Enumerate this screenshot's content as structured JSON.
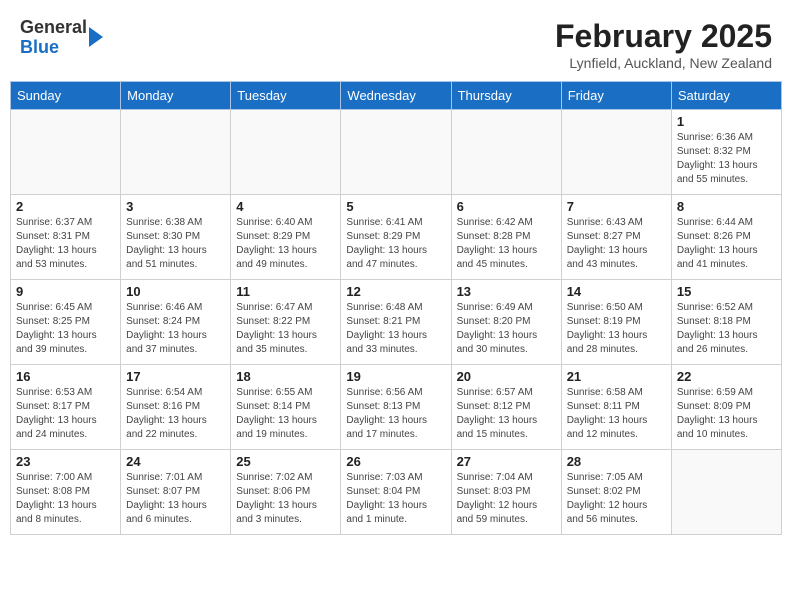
{
  "header": {
    "logo_general": "General",
    "logo_blue": "Blue",
    "month_title": "February 2025",
    "location": "Lynfield, Auckland, New Zealand"
  },
  "days_of_week": [
    "Sunday",
    "Monday",
    "Tuesday",
    "Wednesday",
    "Thursday",
    "Friday",
    "Saturday"
  ],
  "weeks": [
    [
      {
        "day": "",
        "info": ""
      },
      {
        "day": "",
        "info": ""
      },
      {
        "day": "",
        "info": ""
      },
      {
        "day": "",
        "info": ""
      },
      {
        "day": "",
        "info": ""
      },
      {
        "day": "",
        "info": ""
      },
      {
        "day": "1",
        "info": "Sunrise: 6:36 AM\nSunset: 8:32 PM\nDaylight: 13 hours\nand 55 minutes."
      }
    ],
    [
      {
        "day": "2",
        "info": "Sunrise: 6:37 AM\nSunset: 8:31 PM\nDaylight: 13 hours\nand 53 minutes."
      },
      {
        "day": "3",
        "info": "Sunrise: 6:38 AM\nSunset: 8:30 PM\nDaylight: 13 hours\nand 51 minutes."
      },
      {
        "day": "4",
        "info": "Sunrise: 6:40 AM\nSunset: 8:29 PM\nDaylight: 13 hours\nand 49 minutes."
      },
      {
        "day": "5",
        "info": "Sunrise: 6:41 AM\nSunset: 8:29 PM\nDaylight: 13 hours\nand 47 minutes."
      },
      {
        "day": "6",
        "info": "Sunrise: 6:42 AM\nSunset: 8:28 PM\nDaylight: 13 hours\nand 45 minutes."
      },
      {
        "day": "7",
        "info": "Sunrise: 6:43 AM\nSunset: 8:27 PM\nDaylight: 13 hours\nand 43 minutes."
      },
      {
        "day": "8",
        "info": "Sunrise: 6:44 AM\nSunset: 8:26 PM\nDaylight: 13 hours\nand 41 minutes."
      }
    ],
    [
      {
        "day": "9",
        "info": "Sunrise: 6:45 AM\nSunset: 8:25 PM\nDaylight: 13 hours\nand 39 minutes."
      },
      {
        "day": "10",
        "info": "Sunrise: 6:46 AM\nSunset: 8:24 PM\nDaylight: 13 hours\nand 37 minutes."
      },
      {
        "day": "11",
        "info": "Sunrise: 6:47 AM\nSunset: 8:22 PM\nDaylight: 13 hours\nand 35 minutes."
      },
      {
        "day": "12",
        "info": "Sunrise: 6:48 AM\nSunset: 8:21 PM\nDaylight: 13 hours\nand 33 minutes."
      },
      {
        "day": "13",
        "info": "Sunrise: 6:49 AM\nSunset: 8:20 PM\nDaylight: 13 hours\nand 30 minutes."
      },
      {
        "day": "14",
        "info": "Sunrise: 6:50 AM\nSunset: 8:19 PM\nDaylight: 13 hours\nand 28 minutes."
      },
      {
        "day": "15",
        "info": "Sunrise: 6:52 AM\nSunset: 8:18 PM\nDaylight: 13 hours\nand 26 minutes."
      }
    ],
    [
      {
        "day": "16",
        "info": "Sunrise: 6:53 AM\nSunset: 8:17 PM\nDaylight: 13 hours\nand 24 minutes."
      },
      {
        "day": "17",
        "info": "Sunrise: 6:54 AM\nSunset: 8:16 PM\nDaylight: 13 hours\nand 22 minutes."
      },
      {
        "day": "18",
        "info": "Sunrise: 6:55 AM\nSunset: 8:14 PM\nDaylight: 13 hours\nand 19 minutes."
      },
      {
        "day": "19",
        "info": "Sunrise: 6:56 AM\nSunset: 8:13 PM\nDaylight: 13 hours\nand 17 minutes."
      },
      {
        "day": "20",
        "info": "Sunrise: 6:57 AM\nSunset: 8:12 PM\nDaylight: 13 hours\nand 15 minutes."
      },
      {
        "day": "21",
        "info": "Sunrise: 6:58 AM\nSunset: 8:11 PM\nDaylight: 13 hours\nand 12 minutes."
      },
      {
        "day": "22",
        "info": "Sunrise: 6:59 AM\nSunset: 8:09 PM\nDaylight: 13 hours\nand 10 minutes."
      }
    ],
    [
      {
        "day": "23",
        "info": "Sunrise: 7:00 AM\nSunset: 8:08 PM\nDaylight: 13 hours\nand 8 minutes."
      },
      {
        "day": "24",
        "info": "Sunrise: 7:01 AM\nSunset: 8:07 PM\nDaylight: 13 hours\nand 6 minutes."
      },
      {
        "day": "25",
        "info": "Sunrise: 7:02 AM\nSunset: 8:06 PM\nDaylight: 13 hours\nand 3 minutes."
      },
      {
        "day": "26",
        "info": "Sunrise: 7:03 AM\nSunset: 8:04 PM\nDaylight: 13 hours\nand 1 minute."
      },
      {
        "day": "27",
        "info": "Sunrise: 7:04 AM\nSunset: 8:03 PM\nDaylight: 12 hours\nand 59 minutes."
      },
      {
        "day": "28",
        "info": "Sunrise: 7:05 AM\nSunset: 8:02 PM\nDaylight: 12 hours\nand 56 minutes."
      },
      {
        "day": "",
        "info": ""
      }
    ]
  ]
}
